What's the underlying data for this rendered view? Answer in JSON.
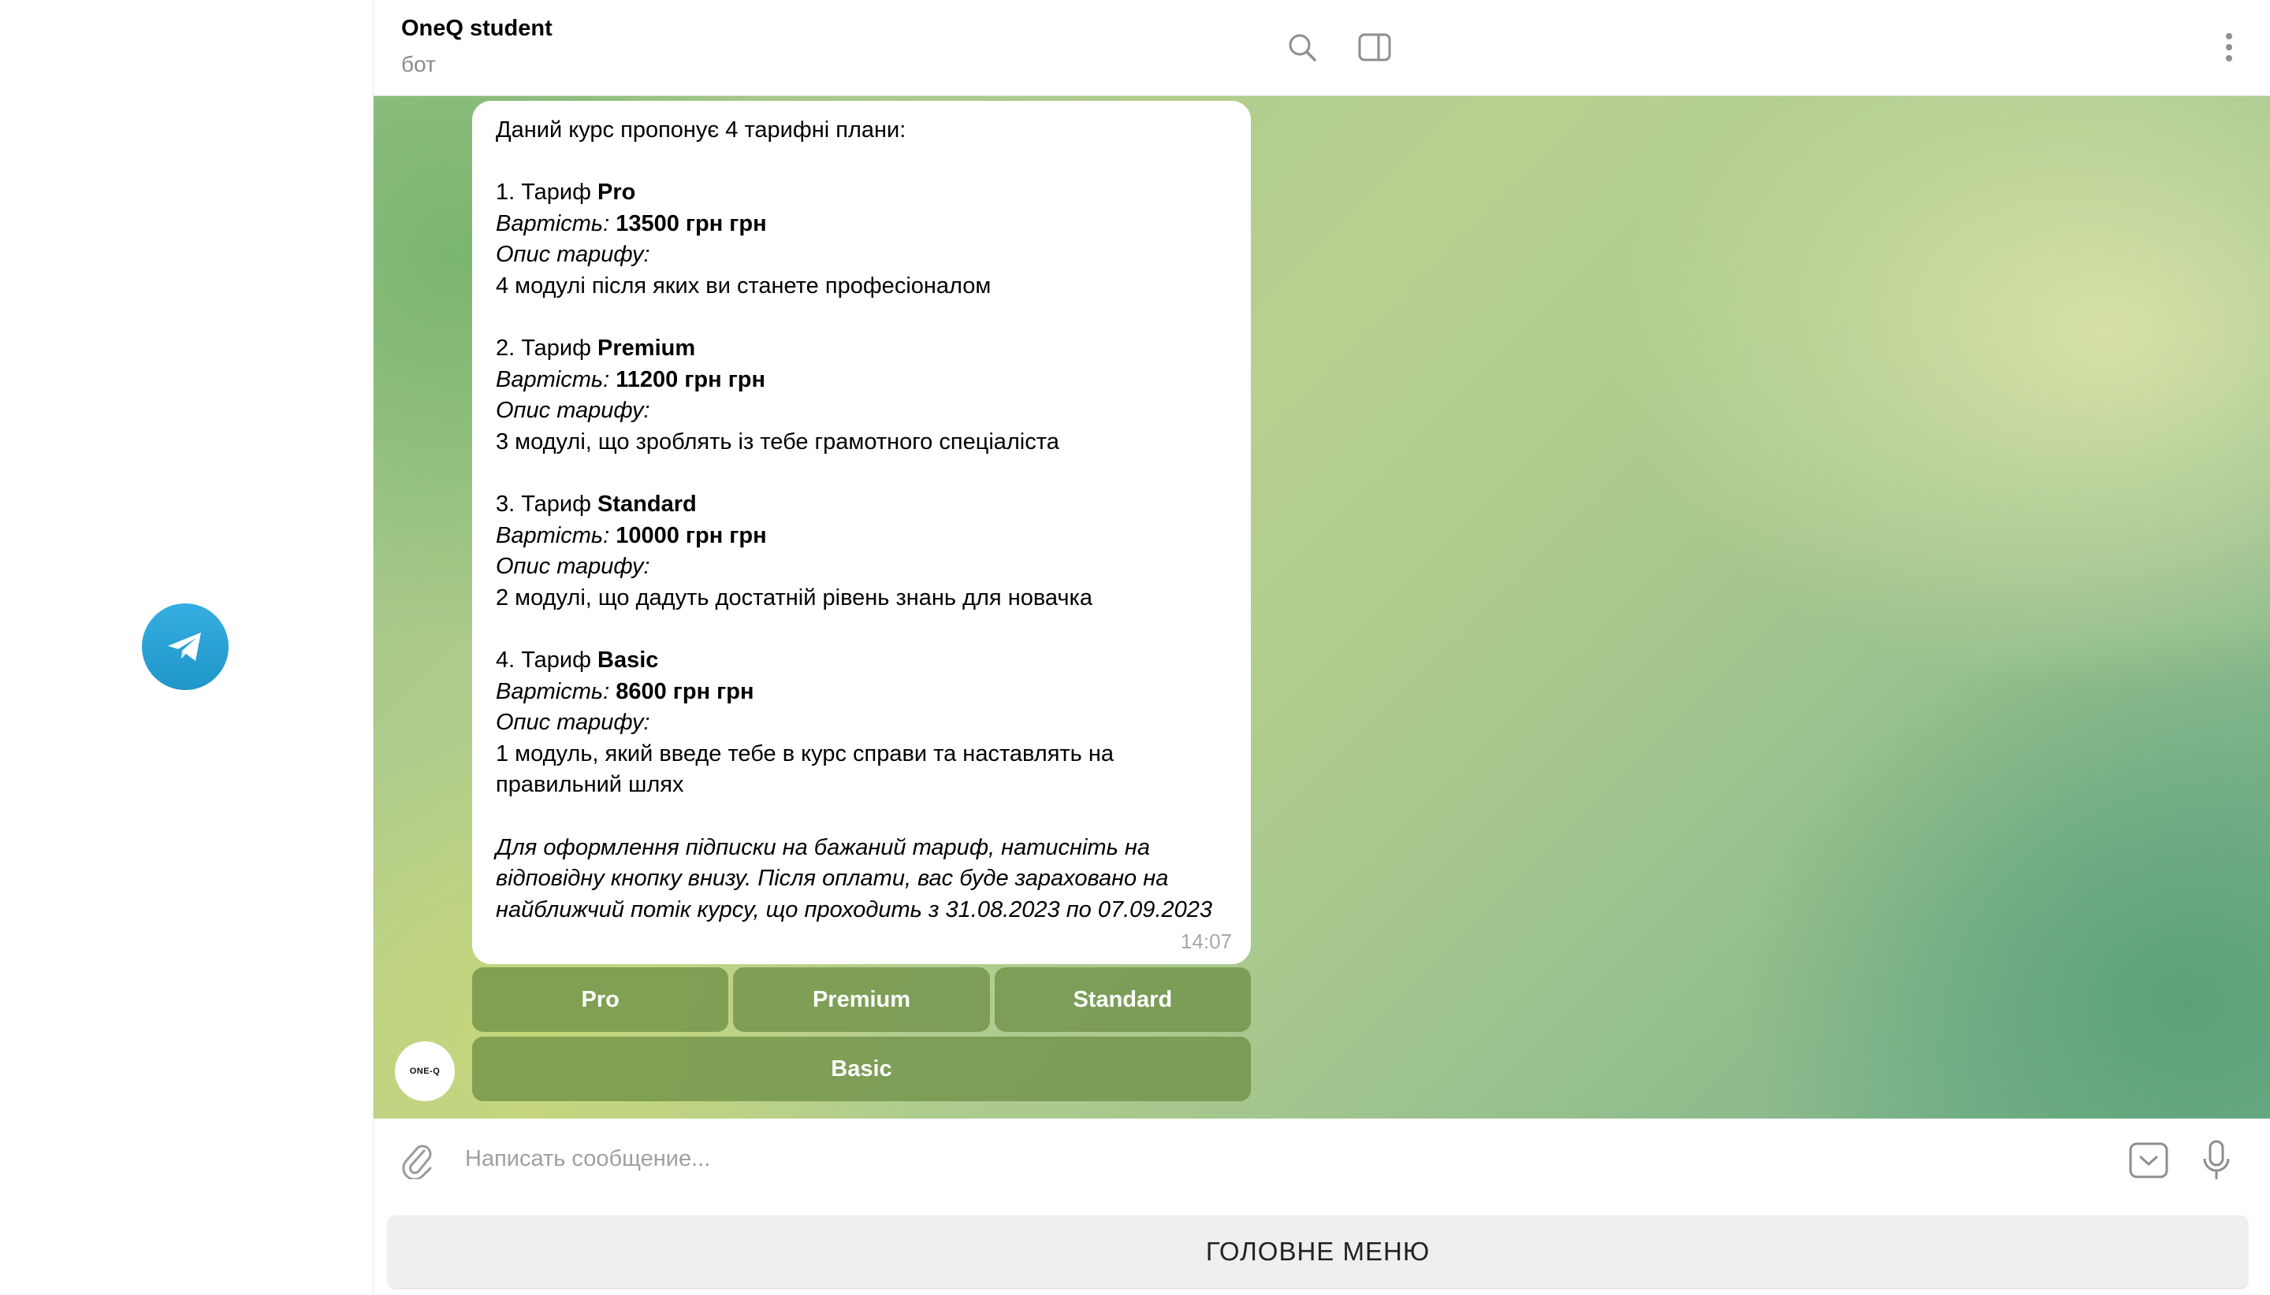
{
  "window": {
    "logo_icon": "telegram-icon"
  },
  "header": {
    "title": "OneQ student",
    "subtitle": "бот",
    "icons": [
      "search-icon",
      "sidebar-toggle-icon",
      "more-vertical-icon"
    ]
  },
  "message": {
    "intro": "Даний курс пропонує 4 тарифні плани:",
    "plans": [
      {
        "prefix": "1. Тариф ",
        "name": "Pro",
        "cost_label": "Вартість:",
        "cost": "13500 грн грн",
        "desc_label": "Опис тарифу:",
        "desc": "4 модулі після яких ви станете професіоналом"
      },
      {
        "prefix": "2. Тариф ",
        "name": "Premium",
        "cost_label": "Вартість:",
        "cost": "11200 грн грн",
        "desc_label": "Опис тарифу:",
        "desc": "3 модулі, що зроблять із тебе грамотного спеціаліста"
      },
      {
        "prefix": "3. Тариф ",
        "name": "Standard",
        "cost_label": "Вартість:",
        "cost": "10000 грн грн",
        "desc_label": "Опис тарифу:",
        "desc": "2 модулі, що дадуть достатній рівень знань для новачка"
      },
      {
        "prefix": "4. Тариф ",
        "name": "Basic",
        "cost_label": "Вартість:",
        "cost": "8600 грн грн",
        "desc_label": "Опис тарифу:",
        "desc_line1": "1 модуль, який введе тебе в курс справи та наставлять на",
        "desc_line2": "правильний шлях"
      }
    ],
    "footer_line1": "Для оформлення підписки на бажаний тариф, натисніть на",
    "footer_line2": "відповідну кнопку внизу. Після оплати, вас буде зараховано на",
    "footer_line3": "найближчий потік курсу, що проходить з 31.08.2023 по 07.09.2023",
    "time": "14:07"
  },
  "keyboard": {
    "row1": [
      "Pro",
      "Premium",
      "Standard"
    ],
    "row2": [
      "Basic"
    ]
  },
  "bot_avatar": {
    "text": "ONE-Q"
  },
  "input": {
    "placeholder": "Написать сообщение...",
    "icons": [
      "paperclip-icon",
      "keyboard-toggle-icon",
      "microphone-icon"
    ]
  },
  "menu_button": {
    "label": "ГОЛОВНЕ МЕНЮ"
  },
  "colors": {
    "accent": "#2aa3dd",
    "keyboard_button": "#6e9146",
    "bubble": "#ffffff"
  }
}
